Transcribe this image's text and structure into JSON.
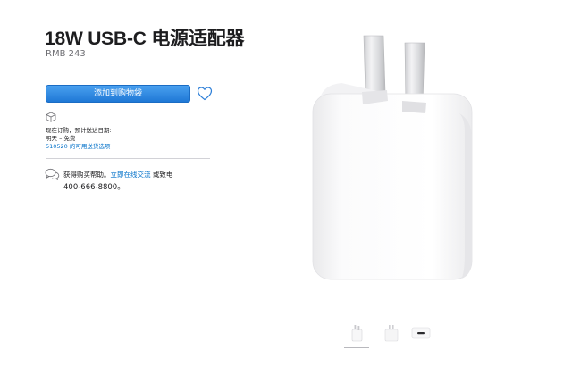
{
  "product": {
    "title": "18W USB-C 电源适配器",
    "price": "RMB 243"
  },
  "actions": {
    "add_to_bag": "添加到购物袋"
  },
  "delivery": {
    "order_line": "现在订购，预计送达日期:",
    "date_line": "明天 – 免费",
    "location_link": "510520 的可用送货选项"
  },
  "help": {
    "prefix": "获得购买帮助。",
    "chat_link": "立即在线交流",
    "suffix": " 或致电",
    "phone": "400-666-8800。"
  },
  "icons": {
    "favorite": "heart-icon",
    "delivery": "box-icon",
    "chat": "chat-bubble-icon"
  },
  "colors": {
    "button": "#1f78d6",
    "link": "#0070c9",
    "text": "#1d1d1f",
    "secondary": "#6e6e73"
  }
}
